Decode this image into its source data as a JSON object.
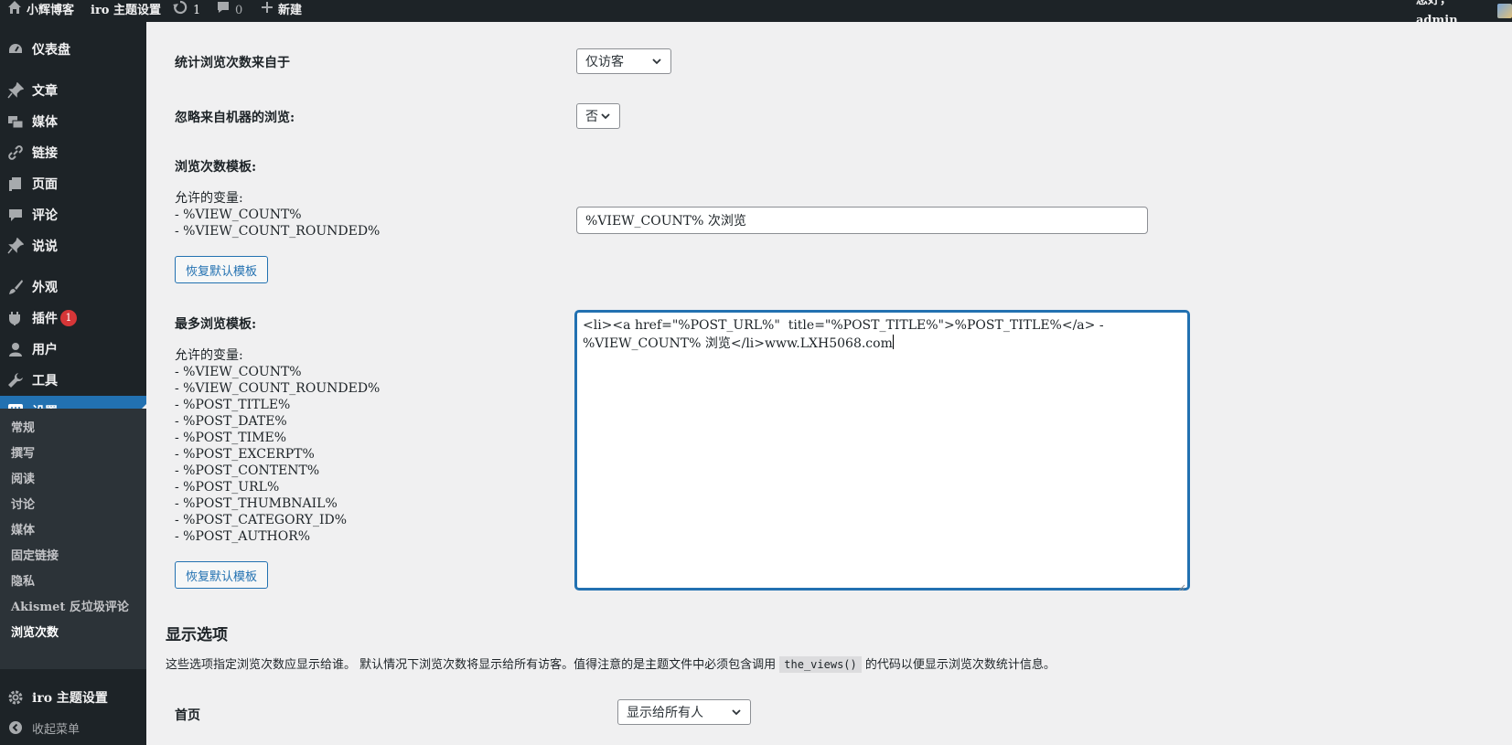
{
  "adminbar": {
    "site_name": "小辉博客",
    "theme_settings": "iro 主题设置",
    "updates_count": "1",
    "comments_count": "0",
    "new_label": "新建",
    "greeting": "您好，admin"
  },
  "sidebar": {
    "items": [
      {
        "label": "仪表盘",
        "icon": "dashboard-icon"
      },
      {
        "label": "文章",
        "icon": "pin-icon"
      },
      {
        "label": "媒体",
        "icon": "media-icon"
      },
      {
        "label": "链接",
        "icon": "link-icon"
      },
      {
        "label": "页面",
        "icon": "page-icon"
      },
      {
        "label": "评论",
        "icon": "comment-icon"
      },
      {
        "label": "说说",
        "icon": "pin-icon"
      },
      {
        "label": "外观",
        "icon": "brush-icon"
      },
      {
        "label": "插件",
        "icon": "plugin-icon",
        "badge": "1"
      },
      {
        "label": "用户",
        "icon": "user-icon"
      },
      {
        "label": "工具",
        "icon": "wrench-icon"
      },
      {
        "label": "设置",
        "icon": "settings-icon"
      }
    ],
    "submenu": [
      "常规",
      "撰写",
      "阅读",
      "讨论",
      "媒体",
      "固定链接",
      "隐私",
      "Akismet 反垃圾评论",
      "浏览次数"
    ],
    "iro_label": "iro 主题设置",
    "collapse_label": "收起菜单"
  },
  "main": {
    "count_from_label": "统计浏览次数来自于",
    "count_from_value": "仅访客",
    "ignore_bots_label": "忽略来自机器的浏览:",
    "ignore_bots_value": "否",
    "view_template_label": "浏览次数模板:",
    "allowed_vars_label": "允许的变量:",
    "view_template_vars": [
      "- %VIEW_COUNT%",
      "- %VIEW_COUNT_ROUNDED%"
    ],
    "view_template_value": "%VIEW_COUNT% 次浏览",
    "restore_button": "恢复默认模板",
    "most_viewed_label": "最多浏览模板:",
    "most_viewed_vars": [
      "- %VIEW_COUNT%",
      "- %VIEW_COUNT_ROUNDED%",
      "- %POST_TITLE%",
      "- %POST_DATE%",
      "- %POST_TIME%",
      "- %POST_EXCERPT%",
      "- %POST_CONTENT%",
      "- %POST_URL%",
      "- %POST_THUMBNAIL%",
      "- %POST_CATEGORY_ID%",
      "- %POST_AUTHOR%"
    ],
    "most_viewed_value": "<li><a href=\"%POST_URL%\"  title=\"%POST_TITLE%\">%POST_TITLE%</a> - %VIEW_COUNT% 浏览</li>www.LXH5068.com",
    "display_heading": "显示选项",
    "display_desc_before": "这些选项指定浏览次数应显示给谁。 默认情况下浏览次数将显示给所有访客。值得注意的是主题文件中必须包含调用",
    "display_desc_code": "the_views()",
    "display_desc_after": "的代码以便显示浏览次数统计信息。",
    "home_label": "首页",
    "home_value": "显示给所有人"
  },
  "colors": {
    "accent": "#2271b1",
    "sidebar_bg": "#1d2327",
    "badge": "#d63638"
  }
}
